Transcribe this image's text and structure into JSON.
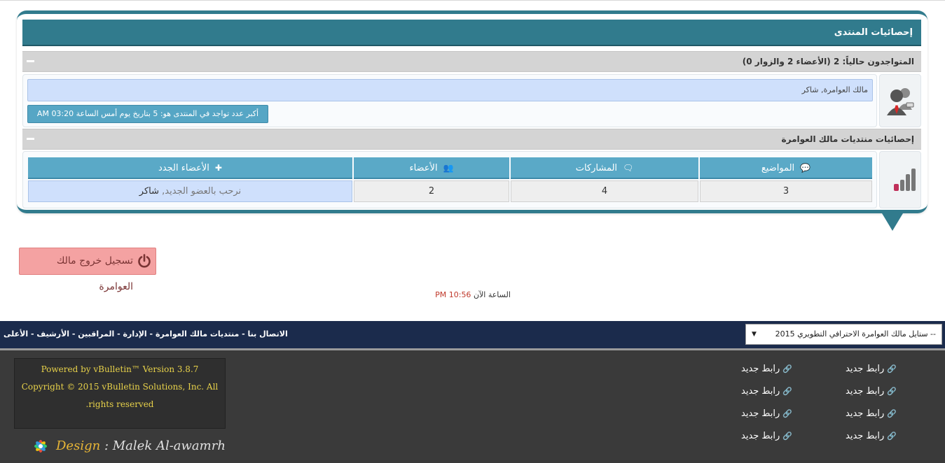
{
  "stats": {
    "title": "إحصائيات المنتدى",
    "online_header": "المتواجدون حالياً: 2 (الأعضاء 2 والزوار 0)",
    "online_names": "مالك العوامرة, شاكر",
    "max_record": "أكبر عدد تواجد في المنتدى هو: 5 بتاريخ يوم أمس الساعة 03:20 AM",
    "forum_stats_header": "إحصائيات منتديات مالك العوامرة",
    "columns": {
      "topics": "المواضيع",
      "posts": "المشاركات",
      "members": "الأعضاء",
      "newest": "الأعضاء الجدد"
    },
    "values": {
      "topics": "3",
      "posts": "4",
      "members": "2",
      "newest_prefix": "نرحب بالعضو الجديد,",
      "newest_name": "شاكر"
    }
  },
  "logout_label": "تسجيل خروج مالك العوامرة",
  "time_now": {
    "label": "الساعة الآن",
    "value": "10:56 PM"
  },
  "navbar": {
    "links": [
      "الاتصال بنا",
      "منتديات مالك العوامرة",
      "الإدارة",
      "المراقبين",
      "الأرشيف",
      "الأعلى"
    ],
    "separator": " - ",
    "style_selected": "-- ستايل مالك العوامرة الاحترافي التطويري 2015",
    "style_arrow": "▼"
  },
  "footer": {
    "powered_by": "Powered by vBulletin™ Version 3.8.7",
    "copyright": "Copyright © 2015 vBulletin Solutions, Inc. All rights reserved.",
    "design_label": "Design",
    "design_sep": ":",
    "designer": "Malek Al-awamrh",
    "links": [
      "رابط جديد",
      "رابط جديد",
      "رابط جديد",
      "رابط جديد",
      "رابط جديد",
      "رابط جديد",
      "رابط جديد",
      "رابط جديد"
    ],
    "link_icon": "🔗"
  },
  "colors": {
    "panel": "#317b8d",
    "table_head": "#5aa9c7",
    "navbar": "#1b2b4c",
    "footer": "#3a3a3a",
    "logout": "#f4a2a2"
  }
}
